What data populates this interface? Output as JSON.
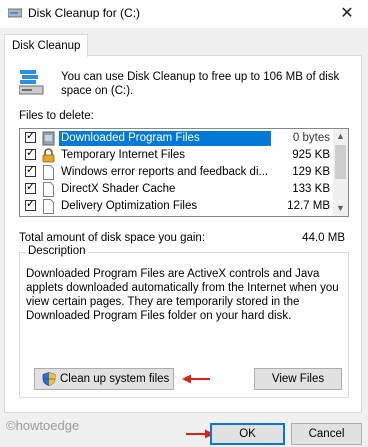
{
  "window": {
    "title": "Disk Cleanup for  (C:)",
    "close_glyph": "✕"
  },
  "tab": {
    "label": "Disk Cleanup"
  },
  "intro": {
    "text": "You can use Disk Cleanup to free up to 106 MB of disk space on  (C:)."
  },
  "files": {
    "label": "Files to delete:",
    "items": [
      {
        "name": "Downloaded Program Files",
        "size": "0 bytes",
        "checked": true,
        "selected": true,
        "icon": "folder-icon"
      },
      {
        "name": "Temporary Internet Files",
        "size": "925 KB",
        "checked": true,
        "selected": false,
        "icon": "lock-icon"
      },
      {
        "name": "Windows error reports and feedback di...",
        "size": "129 KB",
        "checked": true,
        "selected": false,
        "icon": "file-icon"
      },
      {
        "name": "DirectX Shader Cache",
        "size": "133 KB",
        "checked": true,
        "selected": false,
        "icon": "file-icon"
      },
      {
        "name": "Delivery Optimization Files",
        "size": "12.7 MB",
        "checked": true,
        "selected": false,
        "icon": "file-icon"
      }
    ]
  },
  "total": {
    "label": "Total amount of disk space you gain:",
    "value": "44.0 MB"
  },
  "description": {
    "legend": "Description",
    "text": "Downloaded Program Files are ActiveX controls and Java applets downloaded automatically from the Internet when you view certain pages. They are temporarily stored in the Downloaded Program Files folder on your hard disk."
  },
  "buttons": {
    "cleanup_system": "Clean up system files",
    "view_files": "View Files",
    "ok": "OK",
    "cancel": "Cancel"
  },
  "watermark": "©howtoedge",
  "colors": {
    "accent": "#0078d7",
    "arrow": "#e0201c"
  }
}
